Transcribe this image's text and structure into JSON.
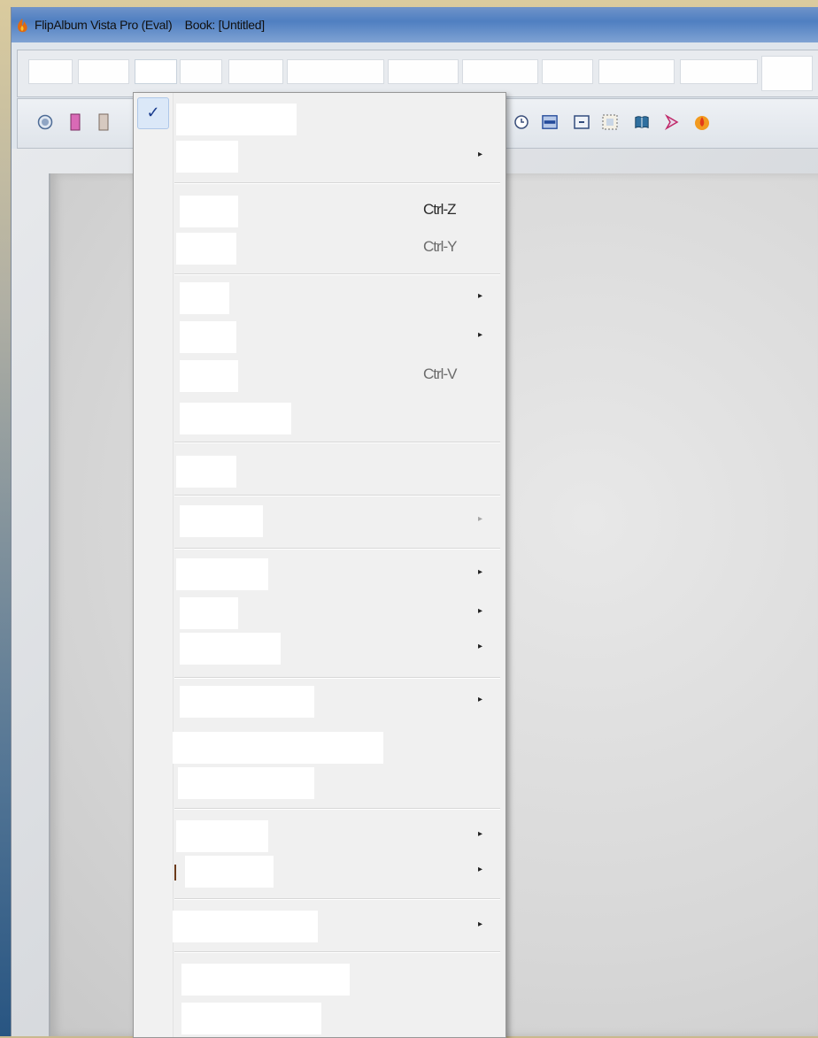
{
  "window": {
    "title": "FlipAlbum Vista Pro (Eval)    Book: [Untitled]"
  },
  "menubar": {
    "items": [
      "",
      "",
      "",
      "",
      "",
      "",
      "",
      "",
      "",
      "",
      "",
      ""
    ]
  },
  "dropdown": {
    "check_glyph": "✓",
    "submenu_glyph": "▸",
    "items": [
      {
        "label": "",
        "shortcut": "",
        "submenu": false,
        "checked": true
      },
      {
        "label": "",
        "shortcut": "",
        "submenu": true
      },
      {
        "label": "",
        "shortcut": "Ctrl-Z",
        "submenu": false
      },
      {
        "label": "",
        "shortcut": "Ctrl-Y",
        "submenu": false
      },
      {
        "label": "",
        "shortcut": "",
        "submenu": true
      },
      {
        "label": "",
        "shortcut": "",
        "submenu": true
      },
      {
        "label": "",
        "shortcut": "Ctrl-V",
        "submenu": false
      },
      {
        "label": "",
        "shortcut": "",
        "submenu": false
      },
      {
        "label": "",
        "shortcut": "",
        "submenu": false
      },
      {
        "label": "",
        "shortcut": "",
        "submenu": true,
        "disabled": true
      },
      {
        "label": "",
        "shortcut": "",
        "submenu": true
      },
      {
        "label": "",
        "shortcut": "",
        "submenu": true
      },
      {
        "label": "",
        "shortcut": "",
        "submenu": true
      },
      {
        "label": "",
        "shortcut": "",
        "submenu": true
      },
      {
        "label": "",
        "shortcut": "",
        "submenu": false
      },
      {
        "label": "",
        "shortcut": "",
        "submenu": false
      },
      {
        "label": "",
        "shortcut": "",
        "submenu": true
      },
      {
        "label": "",
        "shortcut": "",
        "submenu": true
      },
      {
        "label": "",
        "shortcut": "",
        "submenu": true
      },
      {
        "label": "",
        "shortcut": "",
        "submenu": false
      },
      {
        "label": "",
        "shortcut": "",
        "submenu": false
      }
    ]
  },
  "toolbar": {
    "icons": [
      "record-icon",
      "page-pink-icon",
      "page-icon",
      "clock-icon",
      "frame-blue-icon",
      "box-icon",
      "dotted-box-icon",
      "book-icon",
      "arrow-icon",
      "flame-icon"
    ]
  },
  "colors": {
    "titlebar": "#4f7fc1",
    "menu_bg": "#f0f0f0",
    "check_bg": "#dbe8f8"
  }
}
